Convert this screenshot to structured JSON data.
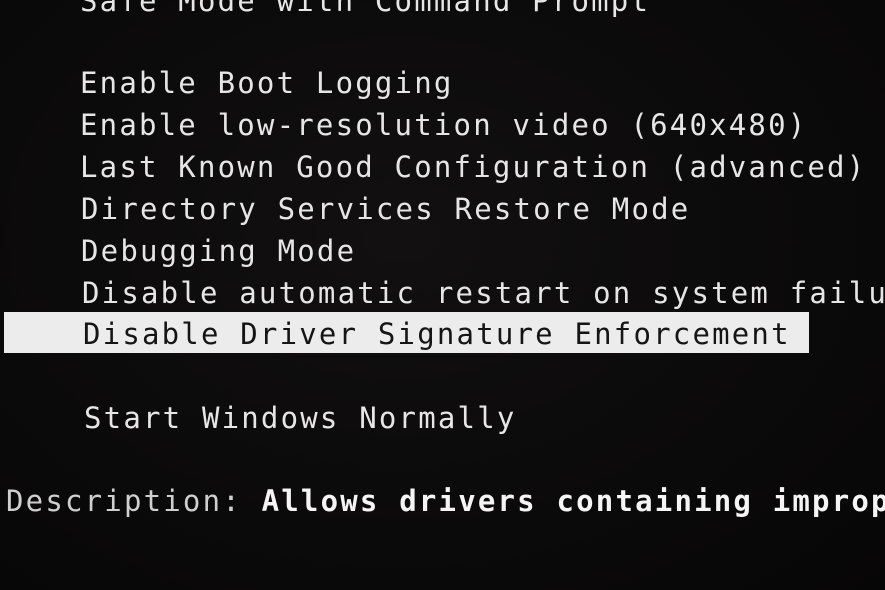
{
  "screen": {
    "type": "Advanced Boot Options",
    "background_color": "#0b0a0a",
    "highlight_color": "#ececec"
  },
  "menu": {
    "partial_top_item": "Safe Mode with Command Prompt",
    "items": [
      {
        "label": "Enable Boot Logging"
      },
      {
        "label": "Enable low-resolution video (640x480)"
      },
      {
        "label": "Last Known Good Configuration (advanced)"
      },
      {
        "label": "Directory Services Restore Mode"
      },
      {
        "label": "Debugging Mode"
      },
      {
        "label": "Disable automatic restart on system failure"
      },
      {
        "label": "Disable Driver Signature Enforcement",
        "selected": true
      }
    ],
    "start_normally": "Start Windows Normally"
  },
  "description": {
    "label": "Description:",
    "text": "Allows drivers containing improper signatures to be loaded."
  }
}
